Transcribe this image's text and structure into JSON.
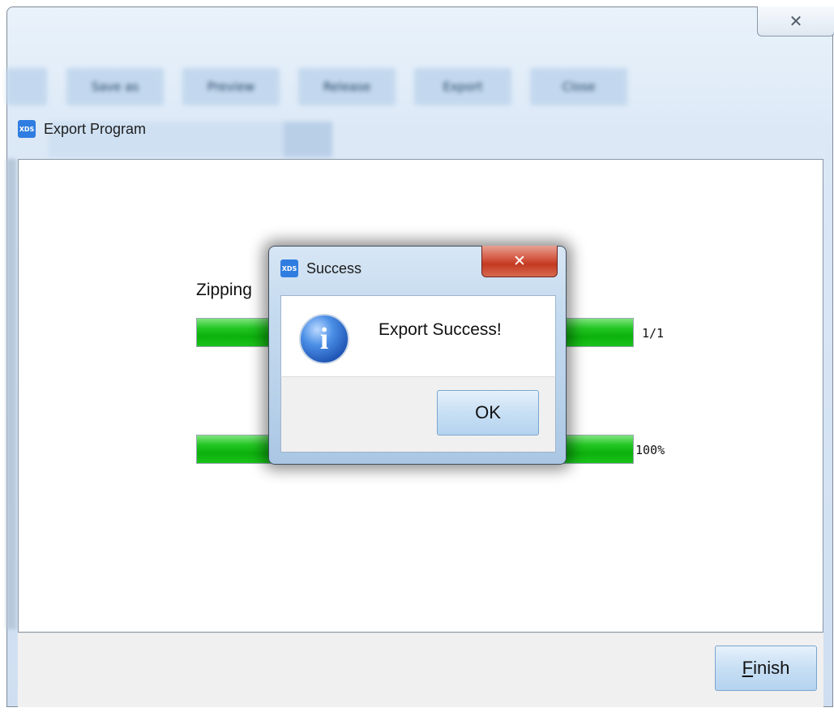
{
  "window": {
    "close_glyph": "✕"
  },
  "background_toolbar": {
    "buttons": [
      "",
      "Save as",
      "Preview",
      "Release",
      "Export",
      "Close"
    ]
  },
  "export_dialog": {
    "title": "Export Program",
    "app_icon_text": "XDS",
    "zip_label": "Zipping",
    "progress_files": {
      "text": "1/1",
      "fraction": 1.0
    },
    "progress_total": {
      "text": "100%",
      "fraction": 1.0
    },
    "finish_button": {
      "mnemonic": "F",
      "rest": "inish"
    }
  },
  "success_dialog": {
    "title": "Success",
    "app_icon_text": "XDS",
    "close_glyph": "✕",
    "icon": "info-icon",
    "icon_glyph": "i",
    "message": "Export Success!",
    "ok_button": "OK"
  },
  "colors": {
    "progress_green": "#0db10d",
    "accent_blue": "#2f7de0",
    "close_red": "#c23a20"
  }
}
